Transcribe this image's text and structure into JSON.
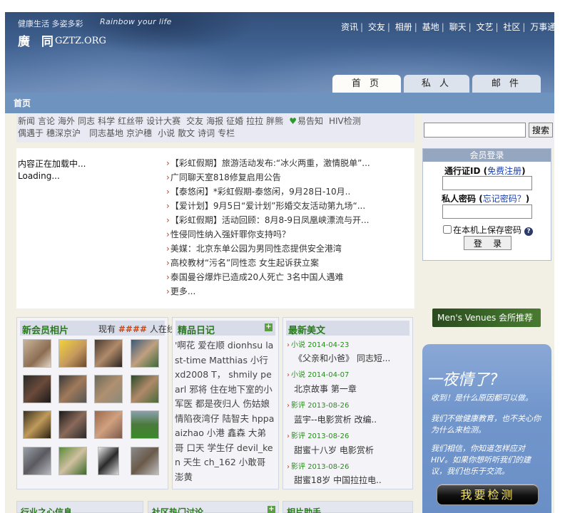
{
  "header": {
    "slogan_cn": "健康生活 多姿多彩",
    "slogan_en": "Rainbow your life",
    "logo_cn": "廣 同",
    "logo_en": "GZTZ.ORG",
    "topnav": [
      "资讯",
      "交友",
      "相册",
      "基地",
      "聊天",
      "文艺",
      "社区",
      "万事通"
    ],
    "tabs": [
      {
        "label": "首 页",
        "active": true
      },
      {
        "label": "私 人",
        "active": false
      },
      {
        "label": "邮 件",
        "active": false
      }
    ]
  },
  "breadcrumb": "首页",
  "catnav": {
    "row1": [
      "新闻",
      "言论",
      "海外",
      "同志",
      "科学",
      "红丝带",
      "设计大赛",
      "交友",
      "海报",
      "征婚",
      "拉拉",
      "胖熊"
    ],
    "row1_special": "易告知",
    "row1_end": "HIV检测",
    "row2": [
      "偶遇于",
      "穗深京沪",
      "同志基地",
      "京沪穗",
      "小说",
      "散文",
      "诗词",
      "专栏"
    ]
  },
  "loading": {
    "line1": "内容正在加载中...",
    "line2": "Loading..."
  },
  "news": [
    "【彩虹假期】旅游活动发布:“冰火两重，激情脱单”...",
    "广同聊天室818修复启用公告",
    "【泰悠闲】*彩虹假期-泰悠闲，9月28日-10月..",
    "【爱计划】9月5日“爱计划”形婚交友活动第九场“...",
    "【彩虹假期】活动回顾：8月8-9日凤凰峡漂流与开...",
    "性侵同性纳入强奸罪你支持吗？",
    "美媒：北京东单公园为男同性恋提供安全港湾",
    "高校教材“污名”同性恋 女生起诉获立案",
    "泰国曼谷爆炸已造成20人死亡 3名中国人遇难",
    "更多..."
  ],
  "members_panel": {
    "title": "新会员相片",
    "online_prefix": "现有",
    "online_count": "####",
    "online_suffix": "人在线"
  },
  "diary_panel": {
    "title": "精品日记",
    "text": "'啊花 爱在顺 dionhsu last-time Matthias 小行 xd2008 T， shmily pearl 邪将 住在地下室的小军医 都是夜归人 伤姑娘 情陷夜湾仔 陆智夫 hppa aizhao 小港 鑫森 大弟哥 口天 学生仔 devil_ken 天生 ch_162 小敢哥 澎黄"
  },
  "articles_panel": {
    "title": "最新美文",
    "items": [
      {
        "tag": "小说",
        "date": "2014-04-23",
        "title": "《父亲和小爸》 同志短..."
      },
      {
        "tag": "小说",
        "date": "2014-04-07",
        "title": "北京故事 第一章"
      },
      {
        "tag": "影评",
        "date": "2013-08-26",
        "title": "蓝宇--电影赏析 改编.."
      },
      {
        "tag": "影评",
        "date": "2013-08-26",
        "title": "甜蜜十八岁 电影赏析"
      },
      {
        "tag": "影评",
        "date": "2013-08-26",
        "title": "甜蜜18岁 中国拉拉电.."
      }
    ]
  },
  "bottom_panels": [
    "行业之心信息",
    "社区热门讨论",
    "相片助手"
  ],
  "search": {
    "button": "搜索",
    "value": ""
  },
  "login": {
    "header": "会员登录",
    "id_label": "通行证ID",
    "register_link": "免费注册",
    "pwd_label": "私人密码",
    "forgot_link": "忘记密码？",
    "remember": "在本机上保存密码",
    "help": "?",
    "button": "登 录"
  },
  "venues_banner": "Men's Venues 会所推荐",
  "promo": {
    "headline": "一夜情了?",
    "p1": "收到！是什么原因都可以做。",
    "p2": "我们不做健康教育，也不关心你为什么来检测。",
    "p3": "我们相信，你知道怎样应对HIV。如果你想听听我们的建议，我们也乐于交流。",
    "button": "我要检测"
  },
  "colors": {
    "header_blue": "#3d5e8c",
    "crumb_blue": "#6f93bf",
    "panel_title_green": "#2a7a1f",
    "news_arrow": "#d04010",
    "test_button_text": "#f3e16a"
  }
}
